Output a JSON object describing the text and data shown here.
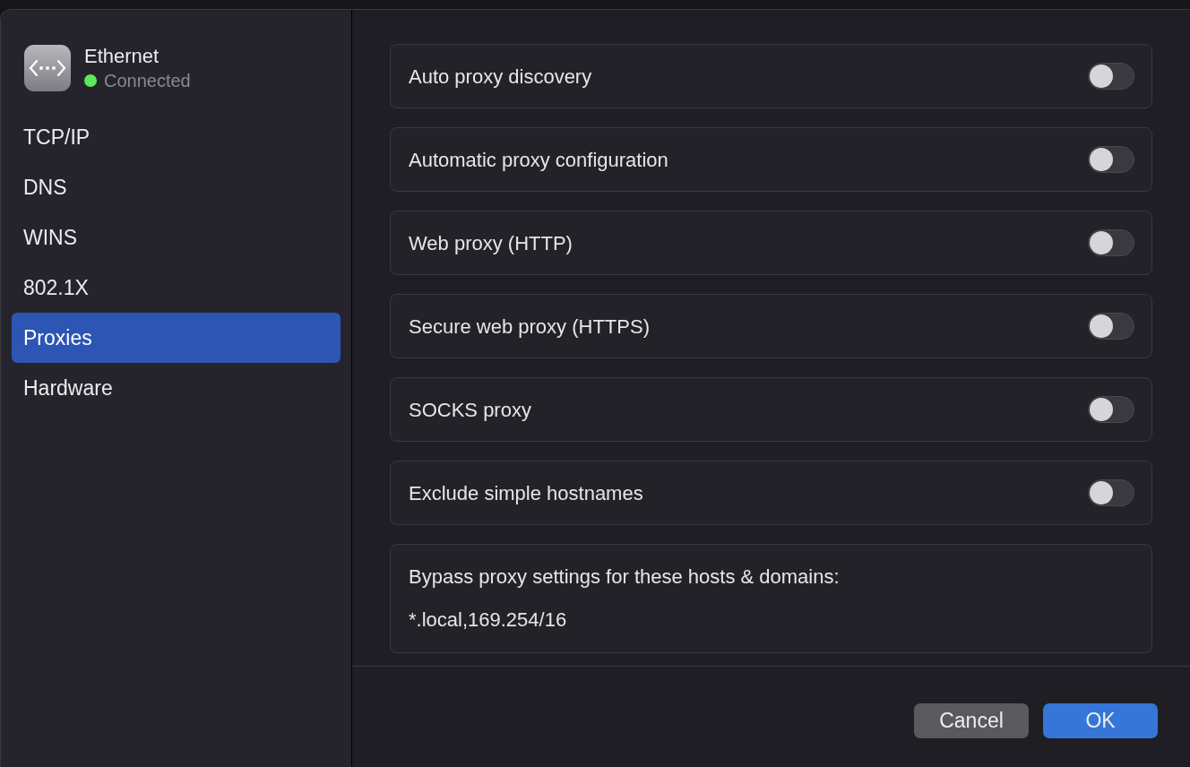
{
  "sidebar": {
    "header": {
      "title": "Ethernet",
      "status": "Connected",
      "color": "#5ee85a"
    },
    "items": [
      {
        "label": "TCP/IP",
        "selected": false
      },
      {
        "label": "DNS",
        "selected": false
      },
      {
        "label": "WINS",
        "selected": false
      },
      {
        "label": "802.1X",
        "selected": false
      },
      {
        "label": "Proxies",
        "selected": true
      },
      {
        "label": "Hardware",
        "selected": false
      }
    ]
  },
  "settings": [
    {
      "label": "Auto proxy discovery",
      "on": false
    },
    {
      "label": "Automatic proxy configuration",
      "on": false
    },
    {
      "label": "Web proxy (HTTP)",
      "on": false
    },
    {
      "label": "Secure web proxy (HTTPS)",
      "on": false
    },
    {
      "label": "SOCKS proxy",
      "on": false
    },
    {
      "label": "Exclude simple hostnames",
      "on": false
    }
  ],
  "bypass": {
    "label": "Bypass proxy settings for these hosts & domains:",
    "value": "*.local,169.254/16"
  },
  "buttons": [
    {
      "label": "Cancel",
      "kind": "secondary"
    },
    {
      "label": "OK",
      "kind": "primary"
    }
  ]
}
